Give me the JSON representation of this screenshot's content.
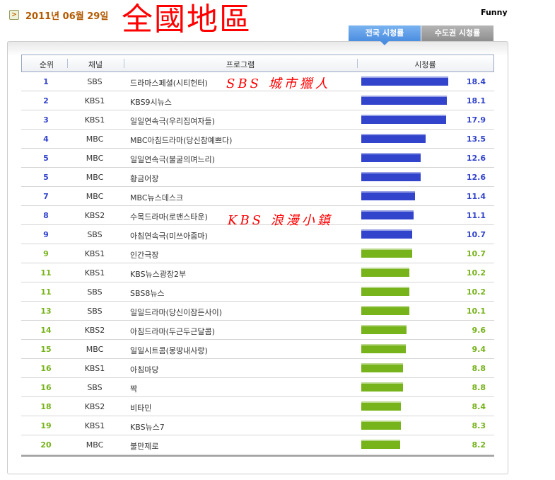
{
  "header": {
    "date": "2011년 06월 29일",
    "title": "全國地區",
    "user": "Funny"
  },
  "tabs": [
    {
      "label": "전국 시청률",
      "active": true
    },
    {
      "label": "수도권 시청률",
      "active": false
    }
  ],
  "columns": [
    "순위",
    "채널",
    "프로그램",
    "시청률"
  ],
  "colors": {
    "blue": "#3344cc",
    "green": "#77b31a"
  },
  "annotations": [
    "SBS 城市獵人",
    "KBS 浪漫小鎮"
  ],
  "rows": [
    {
      "rank": "1",
      "channel": "SBS",
      "program": "드라마스페셜(시티헌터)",
      "rating": 18.4
    },
    {
      "rank": "2",
      "channel": "KBS1",
      "program": "KBS9시뉴스",
      "rating": 18.1
    },
    {
      "rank": "3",
      "channel": "KBS1",
      "program": "일일연속극(우리집여자들)",
      "rating": 17.9
    },
    {
      "rank": "4",
      "channel": "MBC",
      "program": "MBC아침드라마(당신참예쁘다)",
      "rating": 13.5
    },
    {
      "rank": "5",
      "channel": "MBC",
      "program": "일일연속극(불굴의며느리)",
      "rating": 12.6
    },
    {
      "rank": "5",
      "channel": "MBC",
      "program": "황금어장",
      "rating": 12.6
    },
    {
      "rank": "7",
      "channel": "MBC",
      "program": "MBC뉴스데스크",
      "rating": 11.4
    },
    {
      "rank": "8",
      "channel": "KBS2",
      "program": "수목드라마(로맨스타운)",
      "rating": 11.1
    },
    {
      "rank": "9",
      "channel": "SBS",
      "program": "아침연속극(미쓰아줌마)",
      "rating": 10.7
    },
    {
      "rank": "9",
      "channel": "KBS1",
      "program": "인간극장",
      "rating": 10.7
    },
    {
      "rank": "11",
      "channel": "KBS1",
      "program": "KBS뉴스광장2부",
      "rating": 10.2
    },
    {
      "rank": "11",
      "channel": "SBS",
      "program": "SBS8뉴스",
      "rating": 10.2
    },
    {
      "rank": "13",
      "channel": "SBS",
      "program": "일일드라마(당신이잠든사이)",
      "rating": 10.1
    },
    {
      "rank": "14",
      "channel": "KBS2",
      "program": "아침드라마(두근두근달콤)",
      "rating": 9.6
    },
    {
      "rank": "15",
      "channel": "MBC",
      "program": "일일시트콤(몽땅내사랑)",
      "rating": 9.4
    },
    {
      "rank": "16",
      "channel": "KBS1",
      "program": "아침마당",
      "rating": 8.8
    },
    {
      "rank": "16",
      "channel": "SBS",
      "program": "짝",
      "rating": 8.8
    },
    {
      "rank": "18",
      "channel": "KBS2",
      "program": "비타민",
      "rating": 8.4
    },
    {
      "rank": "19",
      "channel": "KBS1",
      "program": "KBS뉴스7",
      "rating": 8.3
    },
    {
      "rank": "20",
      "channel": "MBC",
      "program": "불만제로",
      "rating": 8.2
    }
  ]
}
